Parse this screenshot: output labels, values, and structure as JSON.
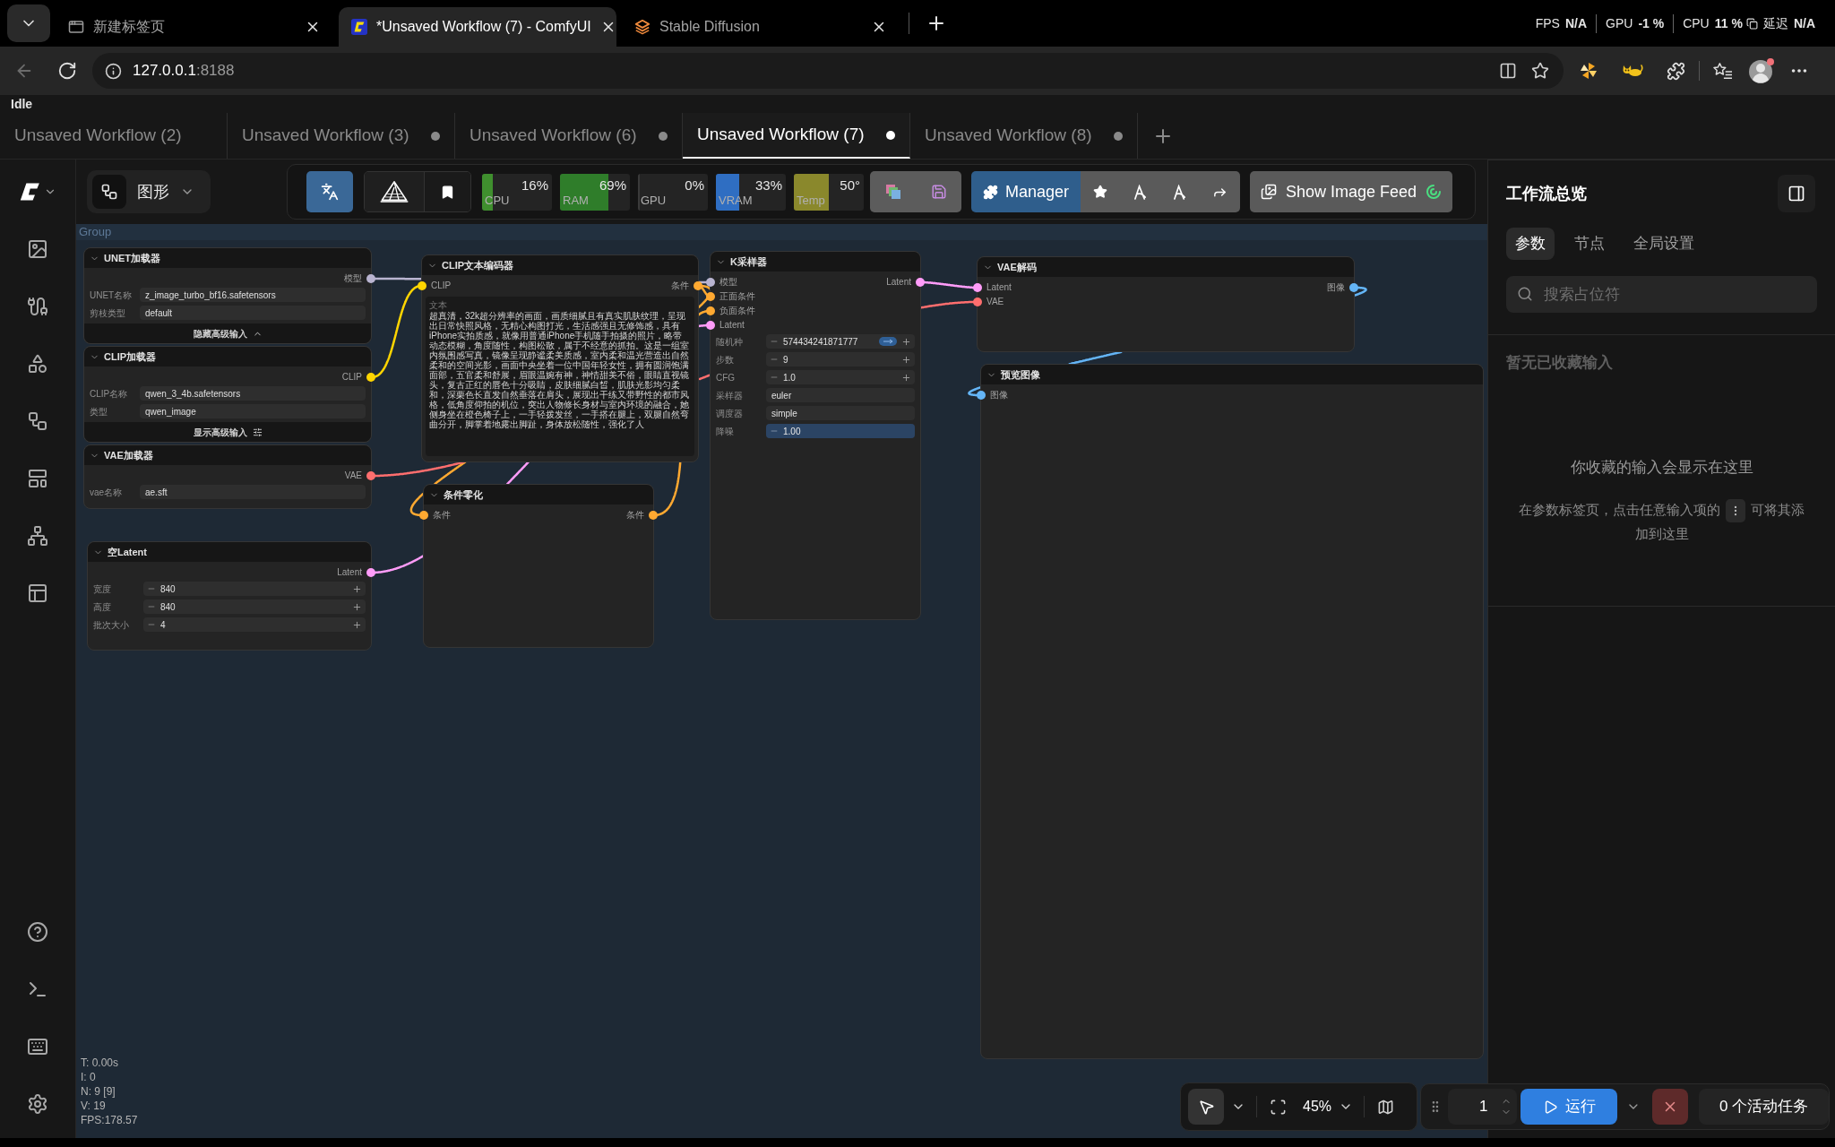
{
  "browser_tabs": [
    {
      "kind": "newtab",
      "title": "新建标签页",
      "selected": false
    },
    {
      "kind": "comfy",
      "title": "*Unsaved Workflow (7) - ComfyUI",
      "selected": true
    },
    {
      "kind": "sd",
      "title": "Stable Diffusion",
      "selected": false
    }
  ],
  "overlay_stats": [
    {
      "label": "FPS",
      "value": "N/A"
    },
    {
      "label": "GPU",
      "value": "-1 %"
    },
    {
      "label": "CPU",
      "value": "11 %"
    },
    {
      "label": "延迟",
      "value": "N/A"
    }
  ],
  "address": {
    "host": "127.0.0.1",
    "port": ":8188"
  },
  "status": "Idle",
  "workflow_tabs": [
    {
      "title": "Unsaved Workflow (2)",
      "selected": false,
      "modified": false
    },
    {
      "title": "Unsaved Workflow (3)",
      "selected": false,
      "modified": true
    },
    {
      "title": "Unsaved Workflow (6)",
      "selected": false,
      "modified": true
    },
    {
      "title": "Unsaved Workflow (7)",
      "selected": true,
      "modified": true
    },
    {
      "title": "Unsaved Workflow (8)",
      "selected": false,
      "modified": true
    }
  ],
  "toolbar": {
    "view": "图形",
    "monitors": [
      {
        "label": "CPU",
        "reading": "16%",
        "level": 0.16,
        "color": "#3f8f2e"
      },
      {
        "label": "RAM",
        "reading": "69%",
        "level": 0.69,
        "color": "#2f7d2a"
      },
      {
        "label": "GPU",
        "reading": "0%",
        "level": 0
      },
      {
        "label": "VRAM",
        "reading": "33%",
        "level": 0.33,
        "color": "#2f6ec2"
      },
      {
        "label": "Temp",
        "reading": "50°",
        "level": 0.5,
        "color": "#8a882c"
      }
    ],
    "manager": "Manager",
    "image_feed": "Show Image Feed"
  },
  "canvas": {
    "group": "Group",
    "nodes": [
      {
        "title": "UNET加载器",
        "outputs": [
          {
            "label": "模型",
            "color": "#b9b4d0"
          }
        ],
        "widgets": [
          {
            "kind": "combo",
            "label": "UNET名称",
            "value": "z_image_turbo_bf16.safetensors"
          },
          {
            "kind": "combo",
            "label": "剪枝类型",
            "value": "default"
          }
        ],
        "footer": {
          "label": "隐藏高级输入",
          "expanded": true
        }
      },
      {
        "title": "CLIP加载器",
        "outputs": [
          {
            "label": "CLIP",
            "color": "#ffd500"
          }
        ],
        "widgets": [
          {
            "kind": "combo",
            "label": "CLIP名称",
            "value": "qwen_3_4b.safetensors"
          },
          {
            "kind": "combo",
            "label": "类型",
            "value": "qwen_image"
          }
        ],
        "footer": {
          "label": "显示高级输入",
          "expanded": false
        }
      },
      {
        "title": "VAE加载器",
        "outputs": [
          {
            "label": "VAE",
            "color": "#ff6e6e"
          }
        ],
        "widgets": [
          {
            "kind": "combo",
            "label": "vae名称",
            "value": "ae.sft"
          }
        ]
      },
      {
        "title": "空Latent",
        "outputs": [
          {
            "label": "Latent",
            "color": "#ff9cf9"
          }
        ],
        "widgets": [
          {
            "kind": "number",
            "label": "宽度",
            "value": "840"
          },
          {
            "kind": "number",
            "label": "高度",
            "value": "840"
          },
          {
            "kind": "number",
            "label": "批次大小",
            "value": "4"
          }
        ]
      },
      {
        "title": "CLIP文本编码器",
        "inputs": [
          {
            "label": "CLIP",
            "color": "#ffd500"
          }
        ],
        "outputs": [
          {
            "label": "条件",
            "color": "#ffa931"
          }
        ],
        "widgets": [
          {
            "kind": "text",
            "label": "文本",
            "value": "超真清，32k超分辨率的画面，画质细腻且有真实肌肤纹理，呈现出日常快照风格，无精心构图打光，生活感强且无修饰感，具有iPhone实拍质感，就像用普通iPhone手机随手拍摄的照片，略带动态模糊，角度随性，构图松散，属于不经意的抓拍。这是一组室内氛围感写真，镜像呈现静谧柔美质感，室内柔和温光营造出自然柔和的空间光影，画面中央坐着一位中国年轻女性，拥有圆润饱满面部，五官柔和舒展，眉眼温婉有神，神情甜美不俗，眼睛直视镜头，复古正红的唇色十分吸睛，皮肤细腻白皙，肌肤光影均匀柔和，深栗色长直发自然垂落在肩头，展现出干练又带野性的都市风格，低角度仰拍的机位，突出人物修长身材与室内环境的融合，她侧身坐在橙色椅子上，一手轻拨发丝，一手搭在腿上，双腿自然弯曲分开，脚掌着地露出脚趾，身体放松随性，强化了人"
          }
        ]
      },
      {
        "title": "条件零化",
        "inputs": [
          {
            "label": "条件",
            "color": "#ffa931"
          }
        ],
        "outputs": [
          {
            "label": "条件",
            "color": "#ffa931"
          }
        ]
      },
      {
        "title": "K采样器",
        "inputs": [
          {
            "label": "模型",
            "color": "#b9b4d0"
          },
          {
            "label": "正面条件",
            "color": "#ffa931"
          },
          {
            "label": "负面条件",
            "color": "#ffa931"
          },
          {
            "label": "Latent",
            "color": "#ff9cf9"
          }
        ],
        "outputs": [
          {
            "label": "Latent",
            "color": "#ff9cf9"
          }
        ],
        "widgets": [
          {
            "kind": "seed",
            "label": "随机种",
            "value": "574434241871777"
          },
          {
            "kind": "number",
            "label": "步数",
            "value": "9"
          },
          {
            "kind": "number",
            "label": "CFG",
            "value": "1.0"
          },
          {
            "kind": "combo",
            "label": "采样器",
            "value": "euler"
          },
          {
            "kind": "combo",
            "label": "调度器",
            "value": "simple"
          },
          {
            "kind": "slider",
            "label": "降噪",
            "value": "1.00",
            "level": 1
          }
        ]
      },
      {
        "title": "VAE解码",
        "inputs": [
          {
            "label": "Latent",
            "color": "#ff9cf9"
          },
          {
            "label": "VAE",
            "color": "#ff6e6e"
          }
        ],
        "outputs": [
          {
            "label": "图像",
            "color": "#64b5f6"
          }
        ]
      },
      {
        "title": "预览图像",
        "inputs": [
          {
            "label": "图像",
            "color": "#64b5f6"
          }
        ]
      }
    ],
    "stats": [
      "T: 0.00s",
      "I: 0",
      "N: 9 [9]",
      "V: 19",
      "FPS:178.57"
    ],
    "zoom": "45%"
  },
  "run_panel": {
    "batch_count": "1",
    "run": "运行",
    "queue": "0 个活动任务"
  },
  "side_panel": {
    "title": "工作流总览",
    "tabs": [
      {
        "label": "参数",
        "selected": true
      },
      {
        "label": "节点",
        "selected": false
      },
      {
        "label": "全局设置",
        "selected": false
      }
    ],
    "search": {
      "placeholder": "搜索占位符"
    },
    "empty_heading": "暂无已收藏输入",
    "empty_title": "你收藏的输入会显示在这里",
    "hint": [
      "在参数标签页，点击任意输入项的",
      "可将其添加到这里"
    ]
  }
}
